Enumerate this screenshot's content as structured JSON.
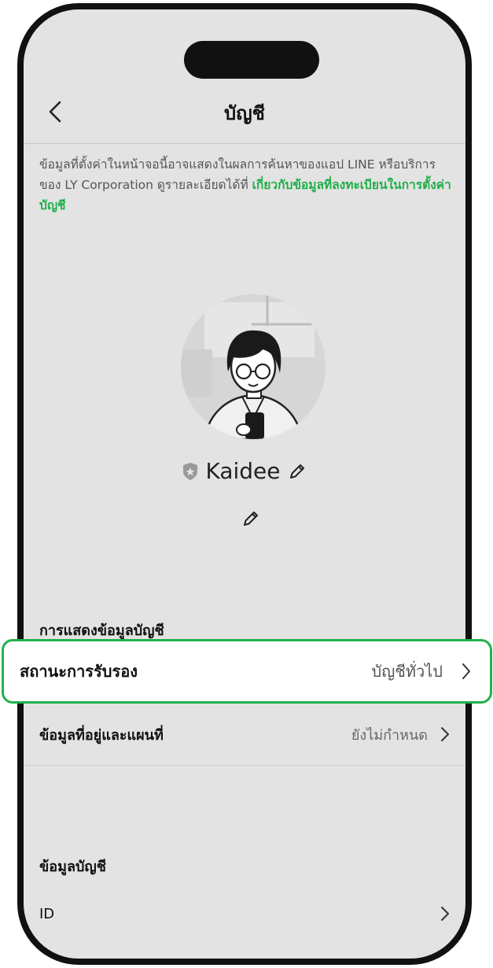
{
  "header": {
    "title": "บัญชี"
  },
  "notice": {
    "text": "ข้อมูลที่ตั้งค่าในหน้าจอนี้อาจแสดงในผลการค้นหาของแอป LINE หรือบริการของ LY Corporation ดูรายละเอียดได้ที่ ",
    "link": "เกี่ยวกับข้อมูลที่ลงทะเบียนในการตั้งค่าบัญชี"
  },
  "profile": {
    "name": "Kaidee"
  },
  "sections": {
    "display_header": "การแสดงข้อมูลบัญชี",
    "verification": {
      "label": "สถานะการรับรอง",
      "value": "บัญชีทั่วไป"
    },
    "location": {
      "label": "ข้อมูลที่อยู่และแผนที่",
      "value": "ยังไม่กำหนด"
    },
    "account_header": "ข้อมูลบัญชี",
    "id": {
      "label": "ID"
    }
  },
  "colors": {
    "accent": "#22b14c",
    "link": "#1fae49",
    "background": "#e3e3e3"
  }
}
